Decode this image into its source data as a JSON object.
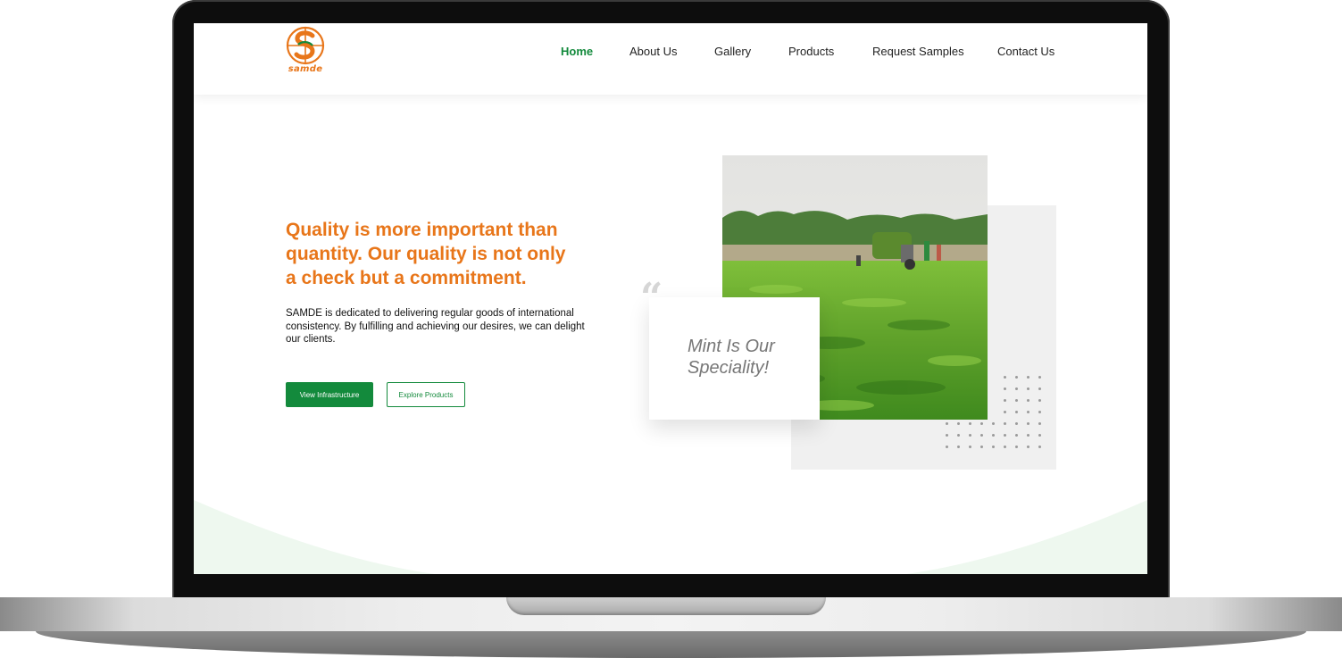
{
  "brand": {
    "name": "SAMDE",
    "logo_text": "samde",
    "accent_orange": "#e8761a",
    "accent_green": "#138a3c"
  },
  "nav": {
    "items": [
      {
        "label": "Home",
        "active": true
      },
      {
        "label": "About Us"
      },
      {
        "label": "Gallery"
      },
      {
        "label": "Products"
      },
      {
        "label": "Request Samples"
      },
      {
        "label": "Contact Us"
      }
    ]
  },
  "hero": {
    "headline_lines": [
      "Quality is more important than",
      "quantity. Our quality is not only",
      "a check but a commitment."
    ],
    "paragraph": "SAMDE is dedicated to delivering regular goods of international consistency. By fulfilling and achieving our desires, we can delight our clients.",
    "primary_button": "View Infrastructure",
    "secondary_button": "Explore Products"
  },
  "quote": {
    "mark": "“",
    "text": "Mint Is Our Speciality!"
  },
  "icons": {
    "quote": "quote-icon",
    "logo": "samde-logo-icon"
  }
}
